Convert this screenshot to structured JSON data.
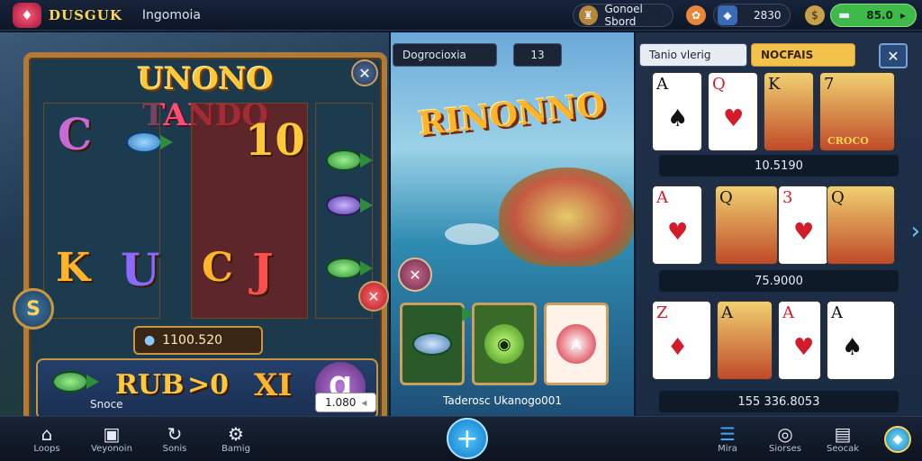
{
  "topbar": {
    "brand": "DUSGUK",
    "tab": "Ingomoia",
    "chip1_label": "Gonoel Sbord",
    "chip2_value": "2830",
    "chip3_value": "85.0",
    "accent": "#3fb94a"
  },
  "slot": {
    "title_a": "UNONO",
    "title_b": "TANDO",
    "symbols": [
      "C",
      "10",
      "K",
      "U",
      "C",
      "J"
    ],
    "bet_value": "1100.520",
    "bottom_symbols": [
      "RUB",
      ">0",
      "XI"
    ],
    "caption": "Snoce",
    "total": "1.080",
    "left_badge": "S"
  },
  "fishing": {
    "tab_label": "Dogrocioxia",
    "tab_count": "13",
    "title": "RINONNO",
    "caption": "Taderosc Ukanogo001"
  },
  "cards": {
    "tab_label": "Tanio vlerig",
    "tab_active": "NOCFAIS",
    "row1_value": "10.5190",
    "row2_value": "75.9000",
    "row3_value": "155 336.8053",
    "row1_caption": "CROCO",
    "row1_ranks": [
      "A",
      "Q",
      "K",
      "7"
    ],
    "row2_ranks": [
      "A",
      "Q",
      "3",
      "Q"
    ],
    "row3_ranks": [
      "Z",
      "A",
      "A",
      "A"
    ]
  },
  "nav": {
    "items": [
      {
        "label": "Loops",
        "icon": "home-icon"
      },
      {
        "label": "Veyonoin",
        "icon": "gallery-icon"
      },
      {
        "label": "Sonis",
        "icon": "refresh-icon"
      },
      {
        "label": "Bamig",
        "icon": "gear-icon"
      },
      {
        "label": "Mira",
        "icon": "list-icon"
      },
      {
        "label": "Siorses",
        "icon": "chat-icon"
      },
      {
        "label": "Seocak",
        "icon": "shop-icon"
      }
    ],
    "fab_icon": "plus-icon"
  }
}
